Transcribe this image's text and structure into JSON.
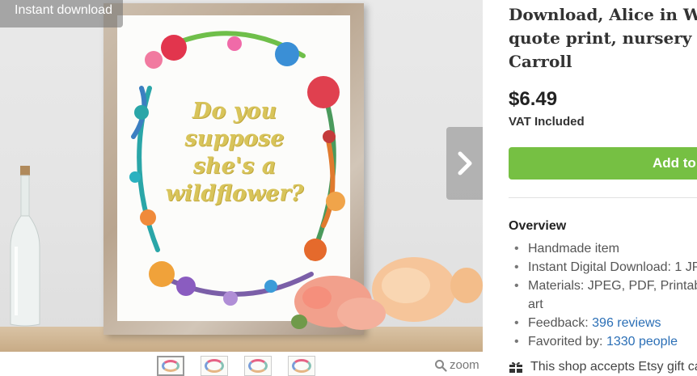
{
  "badge": "Instant download",
  "art": {
    "quote_lines": [
      "Do you",
      "suppose",
      "she's a",
      "wildflower?"
    ]
  },
  "gallery": {
    "zoom_label": "zoom",
    "thumbnail_count": 4
  },
  "product": {
    "title_lines": [
      "Download, Alice in Won",
      "quote print, nursery wa",
      "Carroll"
    ],
    "price": "$6.49",
    "vat": "VAT Included",
    "add_button": "Add to"
  },
  "overview": {
    "heading": "Overview",
    "items": {
      "handmade": "Handmade item",
      "download": "Instant Digital Download: 1 JPG",
      "materials_1": "Materials: JPEG, PDF, Printab",
      "materials_2": "art",
      "feedback_label": "Feedback: ",
      "feedback_link": "396 reviews",
      "favorited_label": "Favorited by: ",
      "favorited_link": "1330 people"
    }
  },
  "gift": "This shop accepts Etsy gift ca",
  "colors": {
    "add_button": "#76c043",
    "link": "#2b6fb6",
    "quote_gold": "#d8c45a"
  }
}
